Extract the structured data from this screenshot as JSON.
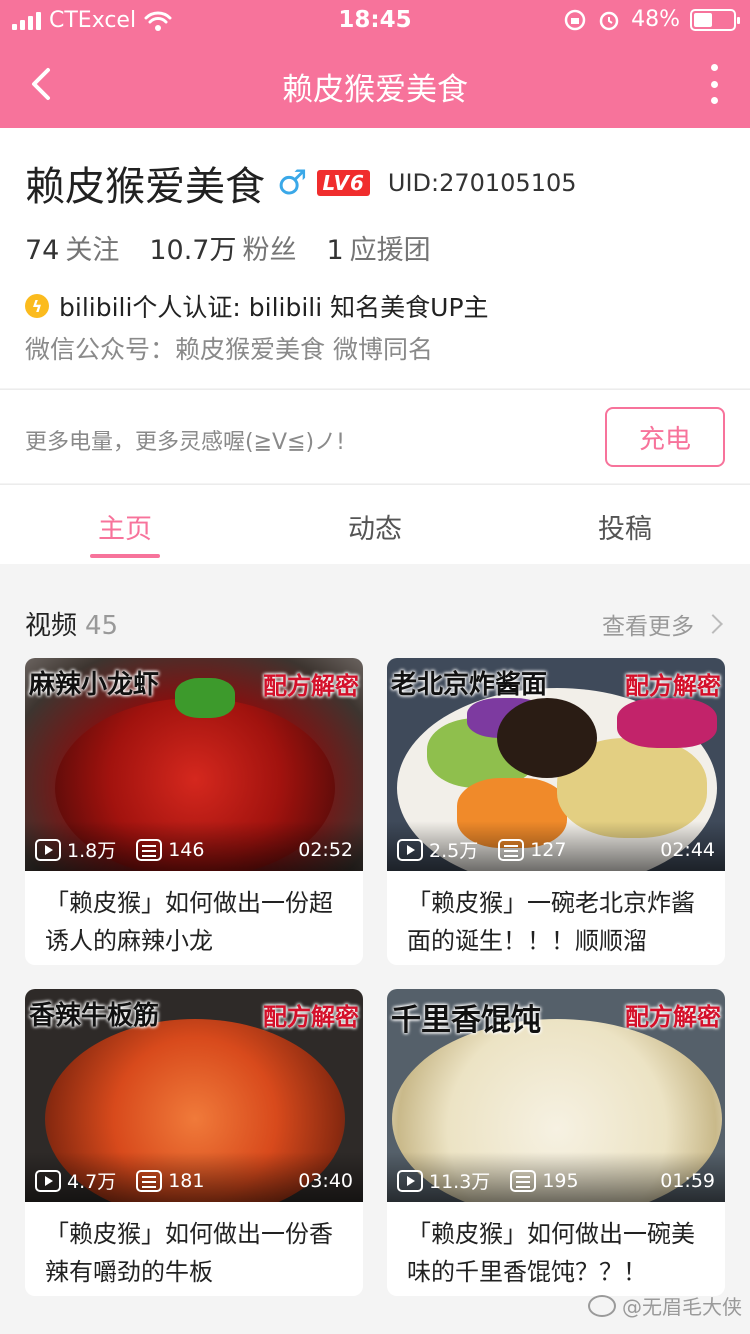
{
  "status_bar": {
    "carrier": "CTExcel",
    "time": "18:45",
    "battery": "48%",
    "battery_level": 0.48
  },
  "nav": {
    "title": "赖皮猴爱美食"
  },
  "profile": {
    "name": "赖皮猴爱美食",
    "gender_symbol": "♂",
    "level": "LV6",
    "uid": "UID:270105105",
    "following_count": "74",
    "following_label": "关注",
    "fans_count": "10.7万",
    "fans_label": "粉丝",
    "support_count": "1",
    "support_label": "应援团",
    "verification": "bilibili个人认证: bilibili 知名美食UP主",
    "signature": "微信公众号：赖皮猴爱美食  微博同名"
  },
  "charge": {
    "hint": "更多电量，更多灵感喔(≧V≦)ノ!",
    "button": "充电"
  },
  "tabs": [
    {
      "label": "主页",
      "active": true
    },
    {
      "label": "动态",
      "active": false
    },
    {
      "label": "投稿",
      "active": false
    }
  ],
  "videos_section": {
    "title": "视频",
    "count": "45",
    "see_more": "查看更多"
  },
  "videos": [
    {
      "tag_left": "麻辣小龙虾",
      "tag_right": "配方解密",
      "views": "1.8万",
      "danmaku": "146",
      "duration": "02:52",
      "title": "「赖皮猴」如何做出一份超诱人的麻辣小龙"
    },
    {
      "tag_left": "老北京炸酱面",
      "tag_right": "配方解密",
      "views": "2.5万",
      "danmaku": "127",
      "duration": "02:44",
      "title": "「赖皮猴」一碗老北京炸酱面的诞生！！！顺顺溜"
    },
    {
      "tag_left": "香辣牛板筋",
      "tag_right": "配方解密",
      "views": "4.7万",
      "danmaku": "181",
      "duration": "03:40",
      "title": "「赖皮猴」如何做出一份香辣有嚼劲的牛板"
    },
    {
      "tag_left": "千里香馄饨",
      "tag_right": "配方解密",
      "views": "11.3万",
      "danmaku": "195",
      "duration": "01:59",
      "title": "「赖皮猴」如何做出一碗美味的千里香馄饨？？！"
    }
  ],
  "watermark": "@无眉毛大侠",
  "colors": {
    "brand_pink": "#f7739b",
    "level_red": "#f02d2d",
    "verify_gold": "#fbbb1e",
    "gender_blue": "#3aa8e8"
  }
}
